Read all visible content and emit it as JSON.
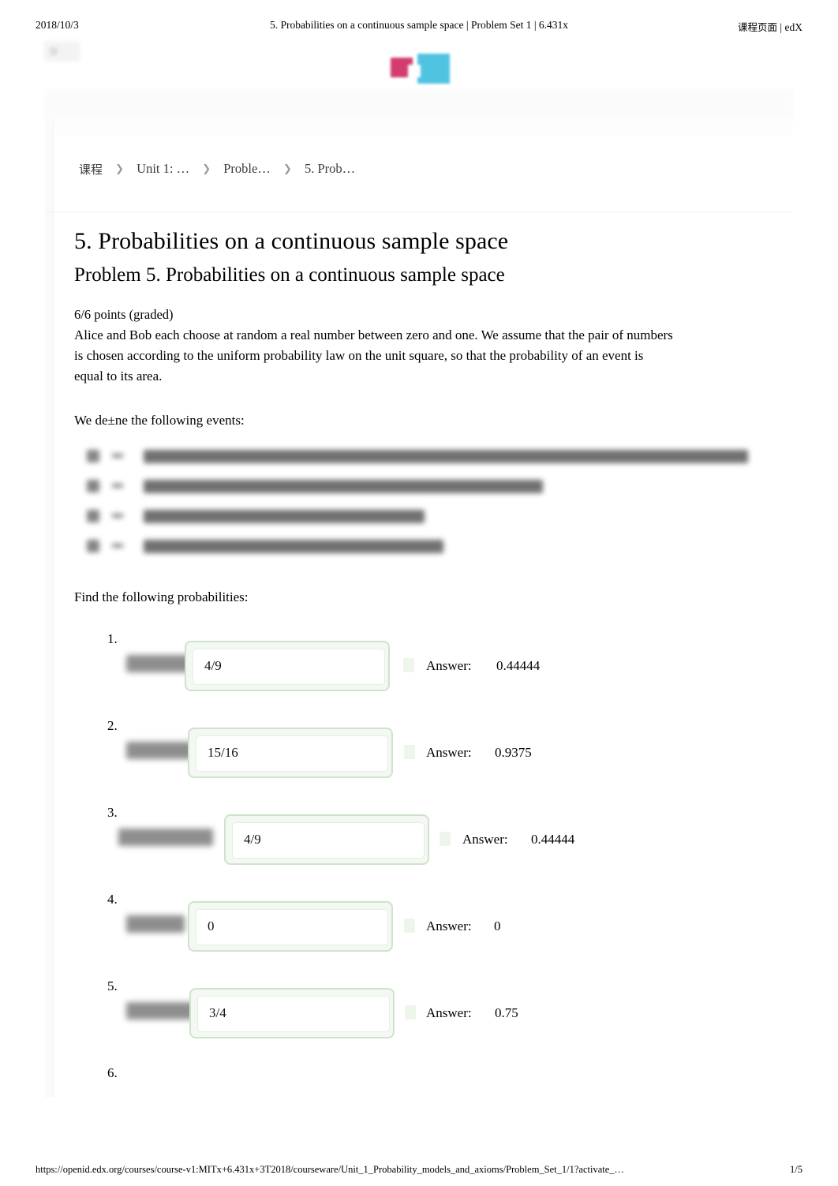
{
  "print_header": {
    "date": "2018/10/3",
    "title": "5. Probabilities on a continuous sample space | Problem Set 1 | 6.431x",
    "right_cn": "课程页面",
    "right_sep": "|",
    "right_brand": "edX"
  },
  "print_footer": {
    "url": "https://openid.edx.org/courses/course-v1:MITx+6.431x+3T2018/courseware/Unit_1_Probability_models_and_axioms/Problem_Set_1/1?activate_…",
    "page": "1/5"
  },
  "breadcrumb": {
    "items": [
      {
        "label": "课程",
        "cn": true
      },
      {
        "label": "Unit 1: …",
        "cn": false
      },
      {
        "label": "Proble…",
        "cn": false
      },
      {
        "label": "5. Prob…",
        "cn": false
      }
    ],
    "separator": "❯"
  },
  "main": {
    "title": "5. Probabilities on a continuous sample space",
    "subtitle": "Problem 5. Probabilities on a continuous sample space",
    "points": "6/6 points (graded)",
    "intro": "Alice and Bob each choose at random a real number between zero and one. We assume that the pair of numbers is chosen according to the uniform probability law on the unit square, so that the probability of an event is equal to its area.",
    "define_line": "We de±ne the following events:",
    "events": [
      "A = {The magnitude of the difference of the two numbers is greater than 1/3}",
      "B = {At least one of the numbers is greater than 1/3}",
      "C = {The sum of the two numbers is 1}",
      "D = {Alice's number is greater than 1/3}"
    ],
    "find_line": "Find the following probabilities:",
    "questions": [
      {
        "number": "1.",
        "expr": "P(A) =",
        "input_value": "4/9",
        "answer_label": "Answer:",
        "answer_value": "0.44444"
      },
      {
        "number": "2.",
        "expr": "P(B) =",
        "input_value": "15/16",
        "answer_label": "Answer:",
        "answer_value": "0.9375"
      },
      {
        "number": "3.",
        "expr": "P(A ∩ B) =",
        "input_value": "4/9",
        "answer_label": "Answer:",
        "answer_value": "0.44444"
      },
      {
        "number": "4.",
        "expr": "P(C) =",
        "input_value": "0",
        "answer_label": "Answer:",
        "answer_value": "0"
      },
      {
        "number": "5.",
        "expr": "P(D) =",
        "input_value": "3/4",
        "answer_label": "Answer:",
        "answer_value": "0.75"
      },
      {
        "number": "6.",
        "expr": "",
        "input_value": "",
        "answer_label": "",
        "answer_value": ""
      }
    ]
  },
  "colors": {
    "input_border": "#cfe3cc",
    "input_fill": "#f3f8f2",
    "logo_pink": "#d23c6e",
    "logo_cyan": "#4fc3e0"
  }
}
